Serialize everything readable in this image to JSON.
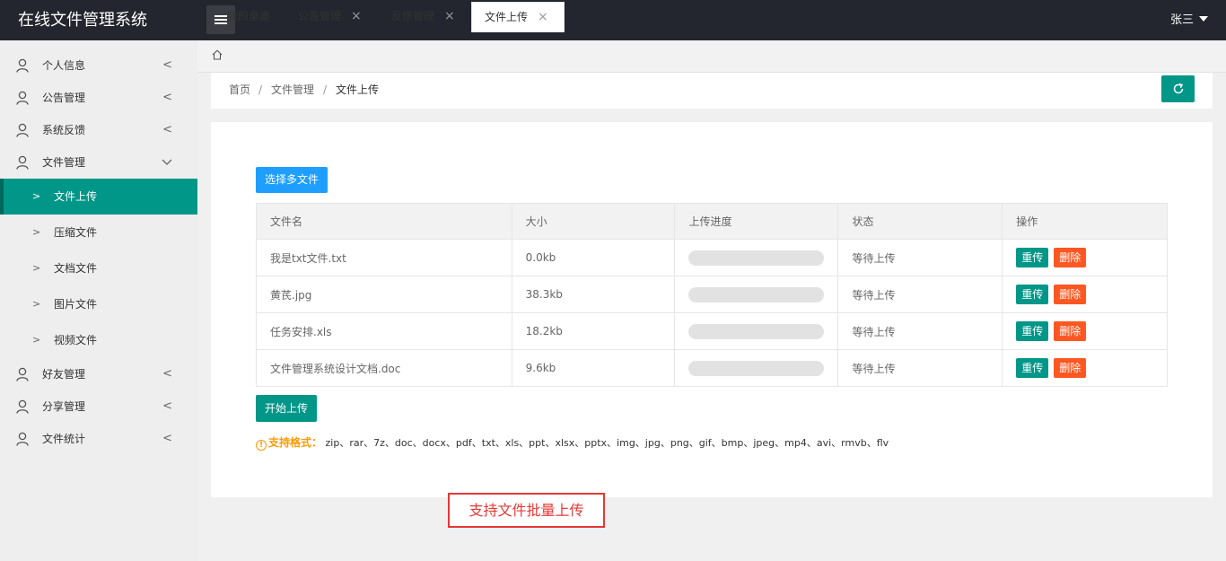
{
  "app": {
    "title": "在线文件管理系统",
    "user": "张三"
  },
  "sidebar": {
    "items": [
      {
        "label": "个人信息",
        "chevron": "<"
      },
      {
        "label": "公告管理",
        "chevron": "<"
      },
      {
        "label": "系统反馈",
        "chevron": "<"
      },
      {
        "label": "文件管理",
        "chevron": "v"
      },
      {
        "label": "好友管理",
        "chevron": "<"
      },
      {
        "label": "分享管理",
        "chevron": "<"
      },
      {
        "label": "文件统计",
        "chevron": "<"
      }
    ],
    "sub_items": [
      {
        "label": "文件上传",
        "active": true
      },
      {
        "label": "压缩文件"
      },
      {
        "label": "文档文件"
      },
      {
        "label": "图片文件"
      },
      {
        "label": "视频文件"
      }
    ]
  },
  "tabs": [
    {
      "label": "我的桌面"
    },
    {
      "label": "公告管理"
    },
    {
      "label": "反馈管理"
    },
    {
      "label": "文件上传",
      "active": true
    }
  ],
  "breadcrumb": [
    "首页",
    "文件管理",
    "文件上传"
  ],
  "breadcrumb_sep": "/",
  "toolbar": {
    "select_label": "选择多文件",
    "start_label": "开始上传"
  },
  "table": {
    "headers": [
      "文件名",
      "大小",
      "上传进度",
      "状态",
      "操作"
    ],
    "rows": [
      {
        "name": "我是txt文件.txt",
        "size": "0.0kb",
        "progress": 0,
        "status": "等待上传"
      },
      {
        "name": "黄芪.jpg",
        "size": "38.3kb",
        "progress": 0,
        "status": "等待上传"
      },
      {
        "name": "任务安排.xls",
        "size": "18.2kb",
        "progress": 0,
        "status": "等待上传"
      },
      {
        "name": "文件管理系统设计文档.doc",
        "size": "9.6kb",
        "progress": 0,
        "status": "等待上传"
      }
    ],
    "reupload_label": "重传",
    "delete_label": "删除"
  },
  "formats": {
    "label": "支持格式：",
    "list": "zip、rar、7z、doc、docx、pdf、txt、xls、ppt、xlsx、pptx、img、jpg、png、gif、bmp、jpeg、mp4、avi、rmvb、flv"
  },
  "callout": "支持文件批量上传",
  "colors": {
    "primary": "#009688",
    "header": "#23262e",
    "blue": "#1e9fff",
    "danger": "#ff5722",
    "warn": "#ff9900"
  }
}
